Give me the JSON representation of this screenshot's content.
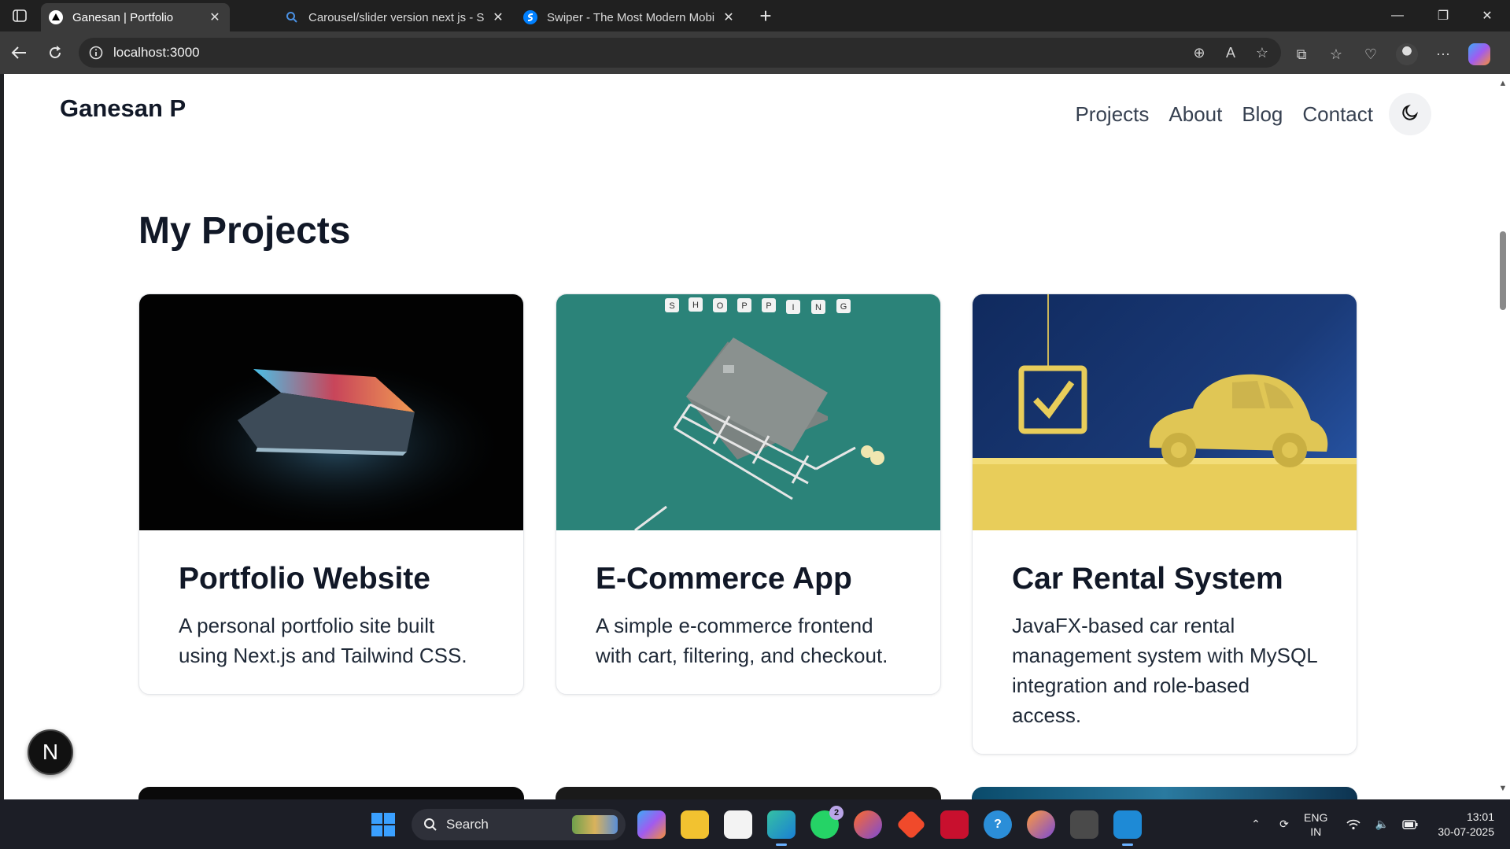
{
  "browser": {
    "tabs": [
      {
        "title": "Ganesan | Portfolio",
        "active": true
      },
      {
        "title": "Carousel/slider version next js - S",
        "active": false
      },
      {
        "title": "Swiper - The Most Modern Mobil",
        "active": false
      }
    ],
    "url": "localhost:3000"
  },
  "site": {
    "brand": "Ganesan P",
    "nav": [
      "Projects",
      "About",
      "Blog",
      "Contact"
    ],
    "heading": "My Projects",
    "projects": [
      {
        "title": "Portfolio Website",
        "description": "A personal portfolio site built using Next.js and Tailwind CSS."
      },
      {
        "title": "E-Commerce App",
        "description": "A simple e-commerce frontend with cart, filtering, and checkout."
      },
      {
        "title": "Car Rental System",
        "description": "JavaFX-based car rental management system with MySQL integration and role-based access."
      }
    ],
    "shopping_tiles": [
      "S",
      "H",
      "O",
      "P",
      "P",
      "I",
      "N",
      "G"
    ],
    "dev_badge": "N"
  },
  "taskbar": {
    "search_label": "Search",
    "whatsapp_badge": "2",
    "language_line1": "ENG",
    "language_line2": "IN",
    "time": "13:01",
    "date": "30-07-2025"
  },
  "colors": {
    "brand_text": "#111827",
    "ecommerce_bg": "#2b8379",
    "car_bg": "#1a3a78",
    "car_yellow": "#e8cd5a"
  }
}
